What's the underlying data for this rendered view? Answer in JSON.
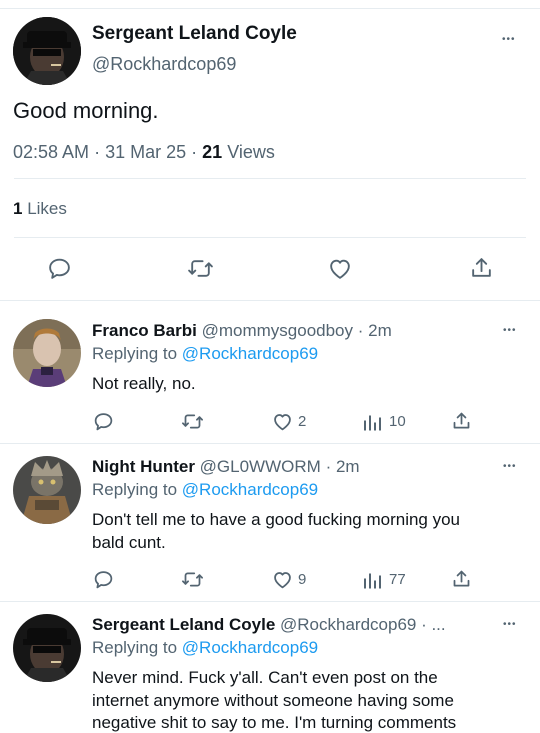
{
  "main_tweet": {
    "display_name": "Sergeant Leland Coyle",
    "handle": "@Rockhardcop69",
    "text": "Good morning.",
    "time": "02:58 AM",
    "date": "31 Mar 25",
    "views_count": "21",
    "views_label": "Views",
    "likes_count": "1",
    "likes_label": "Likes",
    "more": "•••"
  },
  "replies": [
    {
      "display_name": "Franco Barbi",
      "handle": "@mommysgoodboy",
      "time": "· 2m",
      "replying_label": "Replying to",
      "replying_to": "@Rockhardcop69",
      "text": "Not really, no.",
      "likes": "2",
      "views": "10",
      "more": "•••"
    },
    {
      "display_name": "Night Hunter",
      "handle": "@GL0WWORM",
      "time": "· 2m",
      "replying_label": "Replying to",
      "replying_to": "@Rockhardcop69",
      "text_line1": "Don't tell me to have a good fucking morning you",
      "text_line2": "bald cunt.",
      "likes": "9",
      "views": "77",
      "more": "•••"
    },
    {
      "display_name": "Sergeant Leland Coyle",
      "handle": "@Rockhardcop69 · ...",
      "replying_label": "Replying to",
      "replying_to": "@Rockhardcop69",
      "text_line1": "Never mind. Fuck y'all. Can't even post on the",
      "text_line2": "internet anymore without someone having some",
      "text_line3": "negative shit to say to me. I'm turning comments",
      "more": "•••"
    }
  ],
  "icons": [
    "reply-icon",
    "retweet-icon",
    "like-icon",
    "views-icon",
    "share-icon",
    "more-icon"
  ],
  "colors": {
    "link": "#1d9bf0",
    "muted": "#536471",
    "text": "#0f1419",
    "divider": "#e6ecf0"
  }
}
